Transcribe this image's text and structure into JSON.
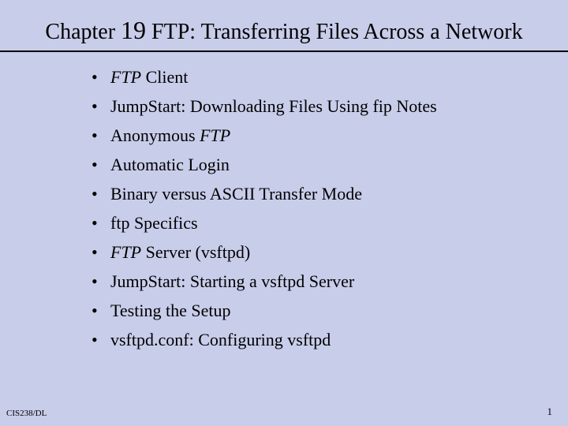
{
  "title": {
    "prefix": "Chapter ",
    "number": "19",
    "rest": " FTP: Transferring Files Across a Network"
  },
  "bullets": [
    {
      "pre_italic": "FTP",
      "post": " Client"
    },
    {
      "text": "JumpStart: Downloading Files Using fip  Notes"
    },
    {
      "pre": "Anonymous ",
      "post_italic": "FTP"
    },
    {
      "text": "Automatic Login"
    },
    {
      "text": "Binary versus ASCII Transfer Mode"
    },
    {
      "text": "ftp Specifics"
    },
    {
      "pre_italic": "FTP",
      "post": " Server (vsftpd)"
    },
    {
      "text": "JumpStart: Starting a vsftpd Server"
    },
    {
      "text": "Testing the Setup"
    },
    {
      "text": "vsftpd.conf: Configuring vsftpd"
    }
  ],
  "footer": {
    "left": "CIS238/DL",
    "right": "1"
  }
}
